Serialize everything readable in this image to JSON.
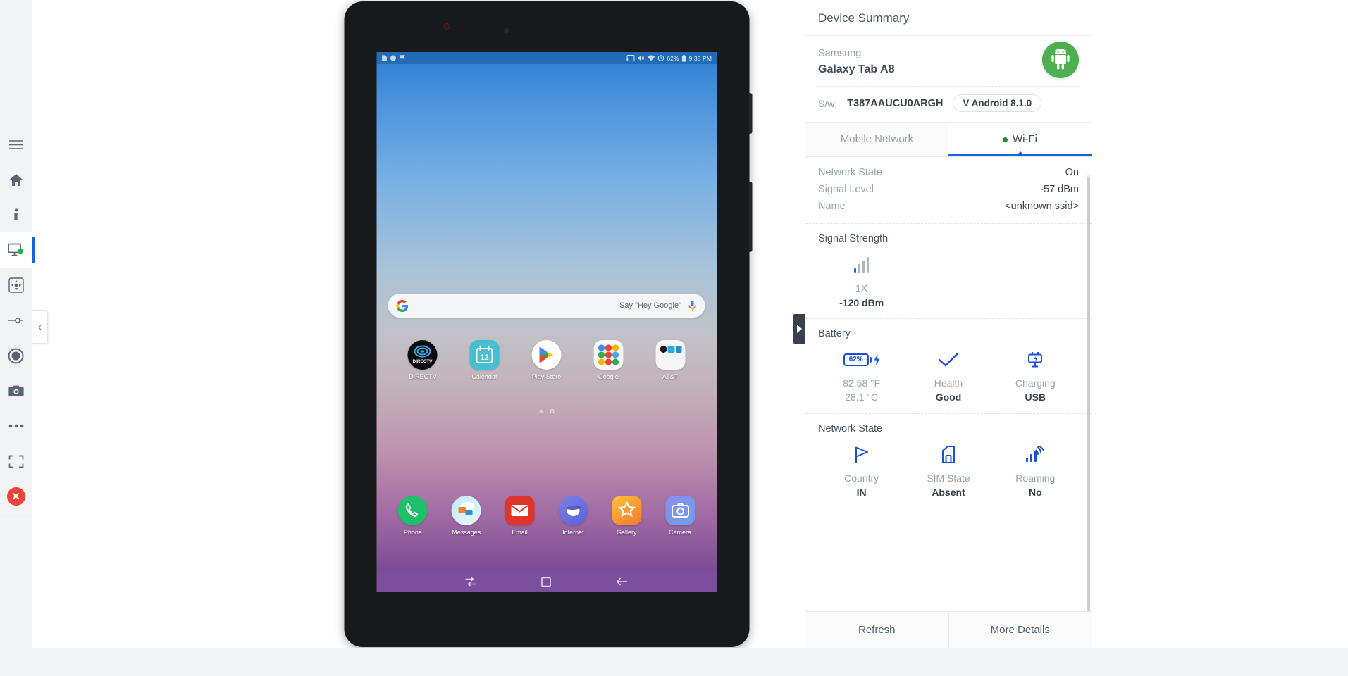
{
  "toolbar": {
    "items": [
      {
        "name": "menu-icon",
        "label": "Menu"
      },
      {
        "name": "home-icon",
        "label": "Home"
      },
      {
        "name": "info-icon",
        "label": "Device Info"
      },
      {
        "name": "monitor-icon",
        "label": "Device Screen"
      },
      {
        "name": "move-icon",
        "label": "Navigate"
      },
      {
        "name": "slider-icon",
        "label": "Settings Slider"
      },
      {
        "name": "record-icon",
        "label": "Record"
      },
      {
        "name": "camera-icon",
        "label": "Screenshot"
      },
      {
        "name": "more-icon",
        "label": "More"
      },
      {
        "name": "fullscreen-icon",
        "label": "Fullscreen"
      },
      {
        "name": "close-icon",
        "label": "Close"
      }
    ],
    "flyout_glyph": "‹"
  },
  "device": {
    "status_bar": {
      "battery": "62%",
      "time": "9:38 PM"
    },
    "search": {
      "hint": "Say \"Hey Google\""
    },
    "apps_row1": [
      {
        "label": "DIRECTV"
      },
      {
        "label": "Calendar",
        "day": "12"
      },
      {
        "label": "Play Store"
      },
      {
        "label": "Google"
      },
      {
        "label": "AT&T"
      }
    ],
    "dock": [
      {
        "label": "Phone"
      },
      {
        "label": "Messages"
      },
      {
        "label": "Email"
      },
      {
        "label": "Internet"
      },
      {
        "label": "Gallery"
      },
      {
        "label": "Camera"
      }
    ],
    "nav": [
      {
        "name": "recents-button"
      },
      {
        "name": "home-button"
      },
      {
        "name": "back-button"
      }
    ]
  },
  "panel": {
    "title": "Device Summary",
    "brand": "Samsung",
    "model": "Galaxy Tab A8",
    "sw_label": "S/w:",
    "sw_value": "T387AAUCU0ARGH",
    "os_version": "V Android 8.1.0",
    "tabs": [
      {
        "label": "Mobile Network",
        "active": false
      },
      {
        "label": "Wi-Fi",
        "active": true
      }
    ],
    "wifi_rows": [
      {
        "key": "Network State",
        "value": "On"
      },
      {
        "key": "Signal Level",
        "value": "-57 dBm"
      },
      {
        "key": "Name",
        "value": "<unknown ssid>"
      }
    ],
    "signal_strength": {
      "title": "Signal Strength",
      "tech": "1X",
      "value": "-120 dBm"
    },
    "battery": {
      "title": "Battery",
      "percent": "62%",
      "metrics": [
        {
          "caption": "82.58 °F",
          "value": "28.1 °C"
        },
        {
          "caption": "Health",
          "value": "Good"
        },
        {
          "caption": "Charging",
          "value": "USB"
        }
      ]
    },
    "network_state": {
      "title": "Network State",
      "metrics": [
        {
          "caption": "Country",
          "value": "IN"
        },
        {
          "caption": "SIM State",
          "value": "Absent"
        },
        {
          "caption": "Roaming",
          "value": "No"
        }
      ]
    },
    "footer": [
      {
        "label": "Refresh"
      },
      {
        "label": "More Details"
      }
    ]
  },
  "colors": {
    "accent_blue": "#1565d8",
    "android_green": "#4caf50",
    "close_red": "#ef4136",
    "nav_purple": "#7c4f9e"
  }
}
